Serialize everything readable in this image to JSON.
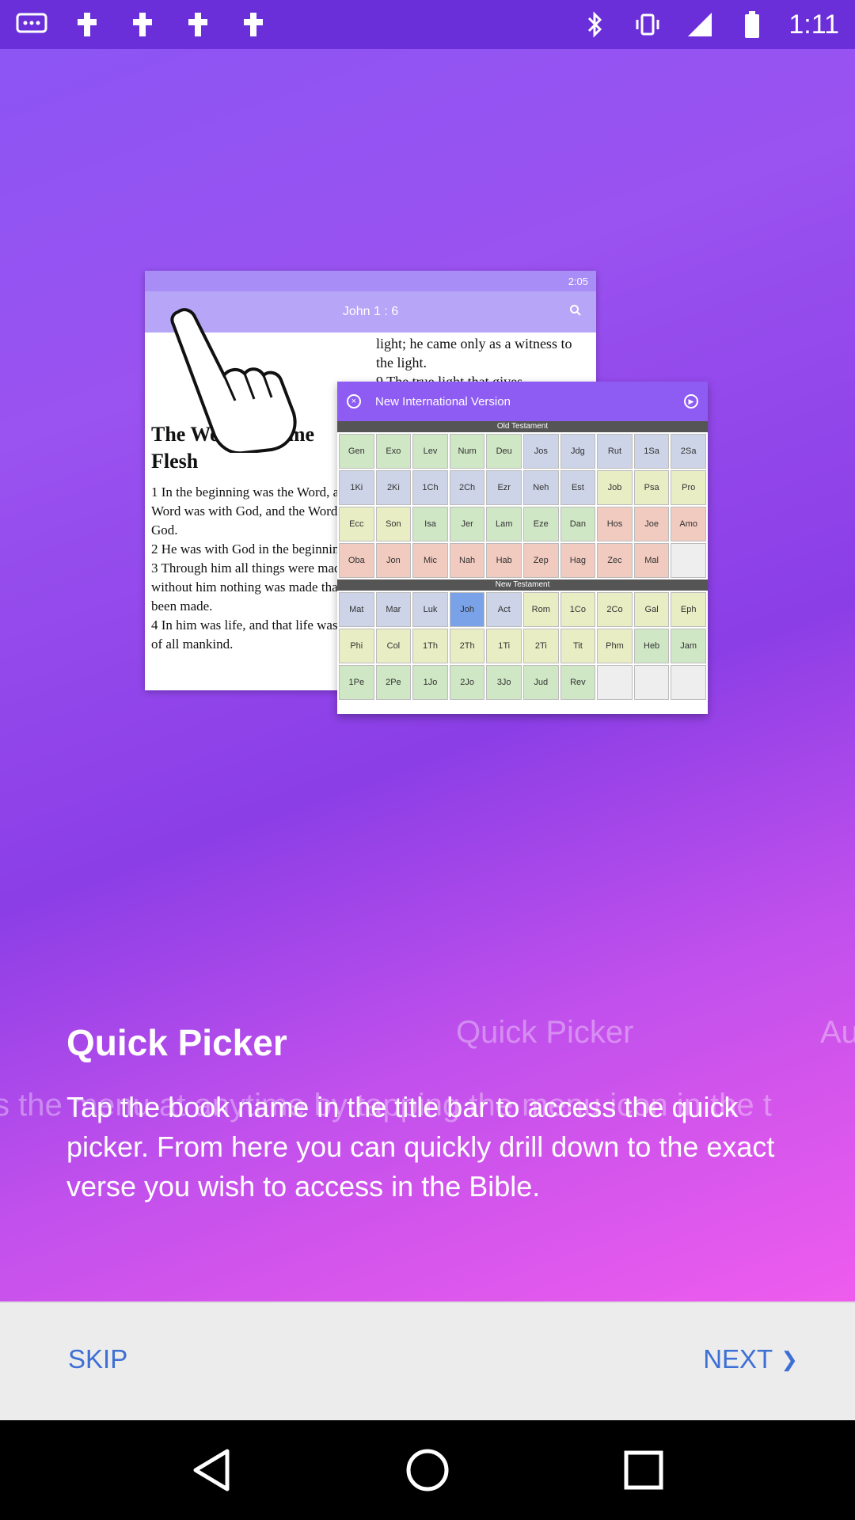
{
  "status_bar": {
    "time": "1:11",
    "icons": [
      "message-icon",
      "notification-icon",
      "notification-icon",
      "notification-icon",
      "notification-icon",
      "bluetooth-icon",
      "vibrate-icon",
      "signal-icon",
      "battery-icon"
    ]
  },
  "illustration": {
    "back_status_time": "2:05",
    "back_title": "John 1 : 6",
    "back_right_text": "light; he came only as a witness to the light.\n9 The true light that gives",
    "back_heading": "The Word Became\nFlesh",
    "back_verses": "1 In the beginning was the Word, and the Word was with God, and the Word was God.\n2 He was with God in the beginning.\n3 Through him all things were made; without him nothing was made that has been made.\n4 In him was life, and that life was the light of all mankind.",
    "picker_title": "New International Version",
    "old_testament_label": "Old Testament",
    "new_testament_label": "New Testament",
    "old_testament": [
      [
        "Gen",
        "green"
      ],
      [
        "Exo",
        "green"
      ],
      [
        "Lev",
        "green"
      ],
      [
        "Num",
        "green"
      ],
      [
        "Deu",
        "green"
      ],
      [
        "Jos",
        "blue"
      ],
      [
        "Jdg",
        "blue"
      ],
      [
        "Rut",
        "blue"
      ],
      [
        "1Sa",
        "blue"
      ],
      [
        "2Sa",
        "blue"
      ],
      [
        "1Ki",
        "blue"
      ],
      [
        "2Ki",
        "blue"
      ],
      [
        "1Ch",
        "blue"
      ],
      [
        "2Ch",
        "blue"
      ],
      [
        "Ezr",
        "blue"
      ],
      [
        "Neh",
        "blue"
      ],
      [
        "Est",
        "blue"
      ],
      [
        "Job",
        "yellow"
      ],
      [
        "Psa",
        "yellow"
      ],
      [
        "Pro",
        "yellow"
      ],
      [
        "Ecc",
        "yellow"
      ],
      [
        "Son",
        "yellow"
      ],
      [
        "Isa",
        "green"
      ],
      [
        "Jer",
        "green"
      ],
      [
        "Lam",
        "green"
      ],
      [
        "Eze",
        "green"
      ],
      [
        "Dan",
        "green"
      ],
      [
        "Hos",
        "pink"
      ],
      [
        "Joe",
        "pink"
      ],
      [
        "Amo",
        "pink"
      ],
      [
        "Oba",
        "pink"
      ],
      [
        "Jon",
        "pink"
      ],
      [
        "Mic",
        "pink"
      ],
      [
        "Nah",
        "pink"
      ],
      [
        "Hab",
        "pink"
      ],
      [
        "Zep",
        "pink"
      ],
      [
        "Hag",
        "pink"
      ],
      [
        "Zec",
        "pink"
      ],
      [
        "Mal",
        "pink"
      ],
      [
        "",
        "empty"
      ]
    ],
    "new_testament": [
      [
        "Mat",
        "blue"
      ],
      [
        "Mar",
        "blue"
      ],
      [
        "Luk",
        "blue"
      ],
      [
        "Joh",
        "sel"
      ],
      [
        "Act",
        "blue"
      ],
      [
        "Rom",
        "yellow"
      ],
      [
        "1Co",
        "yellow"
      ],
      [
        "2Co",
        "yellow"
      ],
      [
        "Gal",
        "yellow"
      ],
      [
        "Eph",
        "yellow"
      ],
      [
        "Phi",
        "yellow"
      ],
      [
        "Col",
        "yellow"
      ],
      [
        "1Th",
        "yellow"
      ],
      [
        "2Th",
        "yellow"
      ],
      [
        "1Ti",
        "yellow"
      ],
      [
        "2Ti",
        "yellow"
      ],
      [
        "Tit",
        "yellow"
      ],
      [
        "Phm",
        "yellow"
      ],
      [
        "Heb",
        "green"
      ],
      [
        "Jam",
        "green"
      ],
      [
        "1Pe",
        "green"
      ],
      [
        "2Pe",
        "green"
      ],
      [
        "1Jo",
        "green"
      ],
      [
        "2Jo",
        "green"
      ],
      [
        "3Jo",
        "green"
      ],
      [
        "Jud",
        "green"
      ],
      [
        "Rev",
        "green"
      ],
      [
        "",
        "empty"
      ],
      [
        "",
        "empty"
      ],
      [
        "",
        "empty"
      ]
    ]
  },
  "slide": {
    "title": "Quick Picker",
    "description": "Tap the book name in the title bar to access the quick picker. From here you can quickly drill down to the exact verse you wish to access in the Bible.",
    "ghost_title": "Quick Picker",
    "ghost_title_next": "Au",
    "ghost_line": "s the menu at anytime by tapping the menu icon in the t"
  },
  "bottom": {
    "skip_label": "SKIP",
    "next_label": "NEXT",
    "next_arrow": "❯"
  },
  "colors": {
    "accent": "#3d6fd4",
    "gradient_top": "#8c55f4",
    "gradient_bottom": "#ee5ced"
  }
}
